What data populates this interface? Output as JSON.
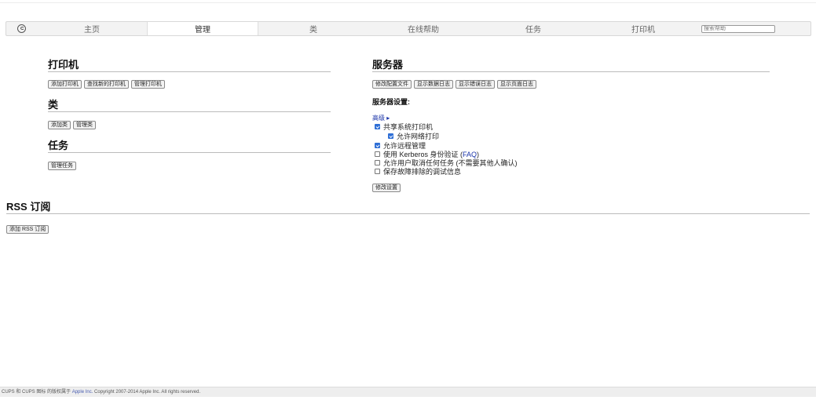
{
  "nav": {
    "tabs": [
      {
        "label": "主页"
      },
      {
        "label": "管理"
      },
      {
        "label": "类"
      },
      {
        "label": "在线帮助"
      },
      {
        "label": "任务"
      },
      {
        "label": "打印机"
      }
    ],
    "active_tab": "管理",
    "search_placeholder": "搜索帮助"
  },
  "printers": {
    "heading": "打印机",
    "buttons": [
      "添加打印机",
      "查找新的打印机",
      "管理打印机"
    ]
  },
  "classes": {
    "heading": "类",
    "buttons": [
      "添加类",
      "管理类"
    ]
  },
  "jobs": {
    "heading": "任务",
    "buttons": [
      "管理任务"
    ]
  },
  "server": {
    "heading": "服务器",
    "buttons": [
      "修改配置文件",
      "显示数据日志",
      "显示错误日志",
      "显示页面日志"
    ],
    "settings_title": "服务器设置:",
    "advanced_label": "高级 ▸",
    "options": [
      {
        "label": "共享系统打印机",
        "checked": true
      },
      {
        "label": "允许网络打印",
        "checked": true
      },
      {
        "label": "允许远程管理",
        "checked": true
      },
      {
        "label": "使用 Kerberos 身份验证 (",
        "link": "FAQ",
        "suffix": ")",
        "checked": false
      },
      {
        "label": "允许用户取消任何任务 (不需要其他人确认)",
        "checked": false
      },
      {
        "label": "保存故障排除的调试信息",
        "checked": false
      }
    ],
    "apply_button": "修改设置"
  },
  "rss": {
    "heading": "RSS 订阅",
    "buttons": [
      "添加 RSS 订阅"
    ]
  },
  "footer": {
    "prefix": "CUPS 和 CUPS 图标 的版权属于 ",
    "link": "Apple Inc.",
    "suffix": " Copyright 2007-2014 Apple Inc. All rights reserved."
  },
  "colors": {
    "link": "#1a33a8",
    "checkbox": "#2f6fd6"
  },
  "icons": {
    "logo": "cups-logo-icon",
    "checkbox": "checkbox-icon"
  }
}
